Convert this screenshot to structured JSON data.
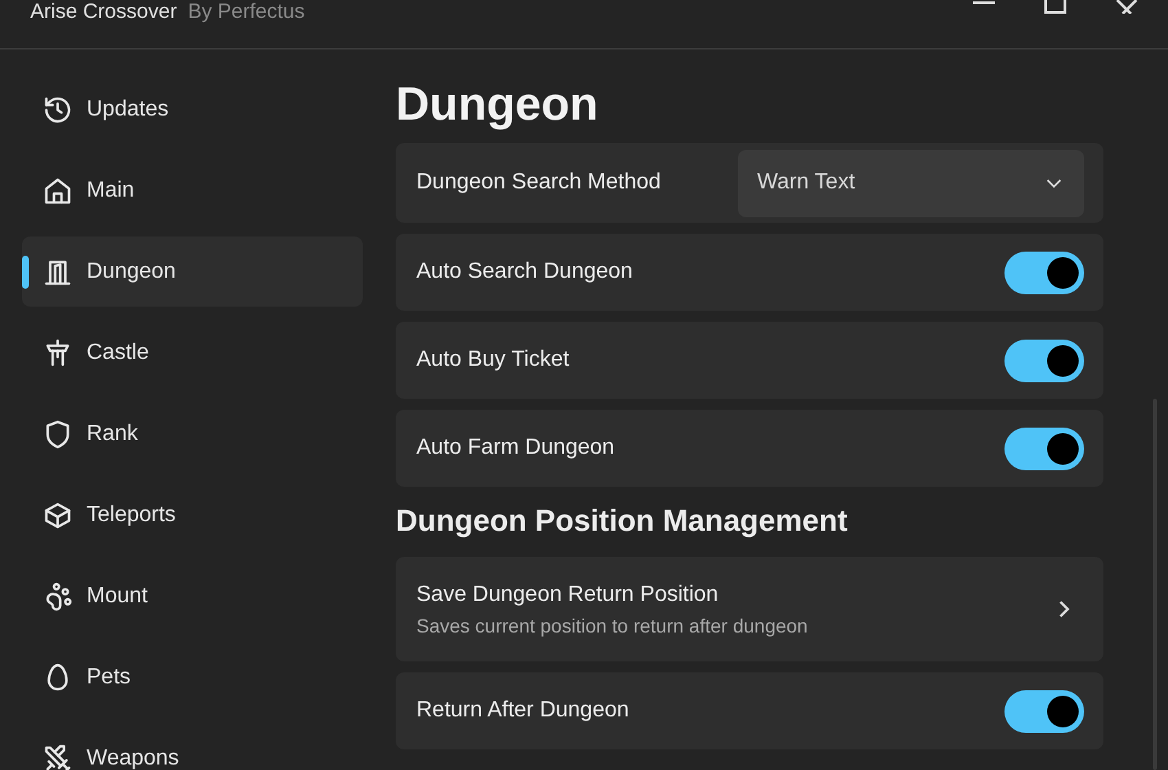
{
  "window": {
    "title": "Arise Crossover",
    "subtitle": "By Perfectus"
  },
  "sidebar": {
    "items": [
      {
        "label": "Updates",
        "selected": false
      },
      {
        "label": "Main",
        "selected": false
      },
      {
        "label": "Dungeon",
        "selected": true
      },
      {
        "label": "Castle",
        "selected": false
      },
      {
        "label": "Rank",
        "selected": false
      },
      {
        "label": "Teleports",
        "selected": false
      },
      {
        "label": "Mount",
        "selected": false
      },
      {
        "label": "Pets",
        "selected": false
      },
      {
        "label": "Weapons",
        "selected": false
      }
    ]
  },
  "page": {
    "title": "Dungeon",
    "sections": [
      {
        "rows": [
          {
            "kind": "dropdown",
            "label": "Dungeon Search Method",
            "value": "Warn Text"
          },
          {
            "kind": "toggle",
            "label": "Auto Search Dungeon",
            "on": true
          },
          {
            "kind": "toggle",
            "label": "Auto Buy Ticket",
            "on": true
          },
          {
            "kind": "toggle",
            "label": "Auto Farm Dungeon",
            "on": true
          }
        ]
      },
      {
        "title": "Dungeon Position Management",
        "rows": [
          {
            "kind": "button",
            "label": "Save Dungeon Return Position",
            "description": "Saves current position to return after dungeon"
          },
          {
            "kind": "toggle",
            "label": "Return After Dungeon",
            "on": true
          }
        ]
      }
    ]
  }
}
